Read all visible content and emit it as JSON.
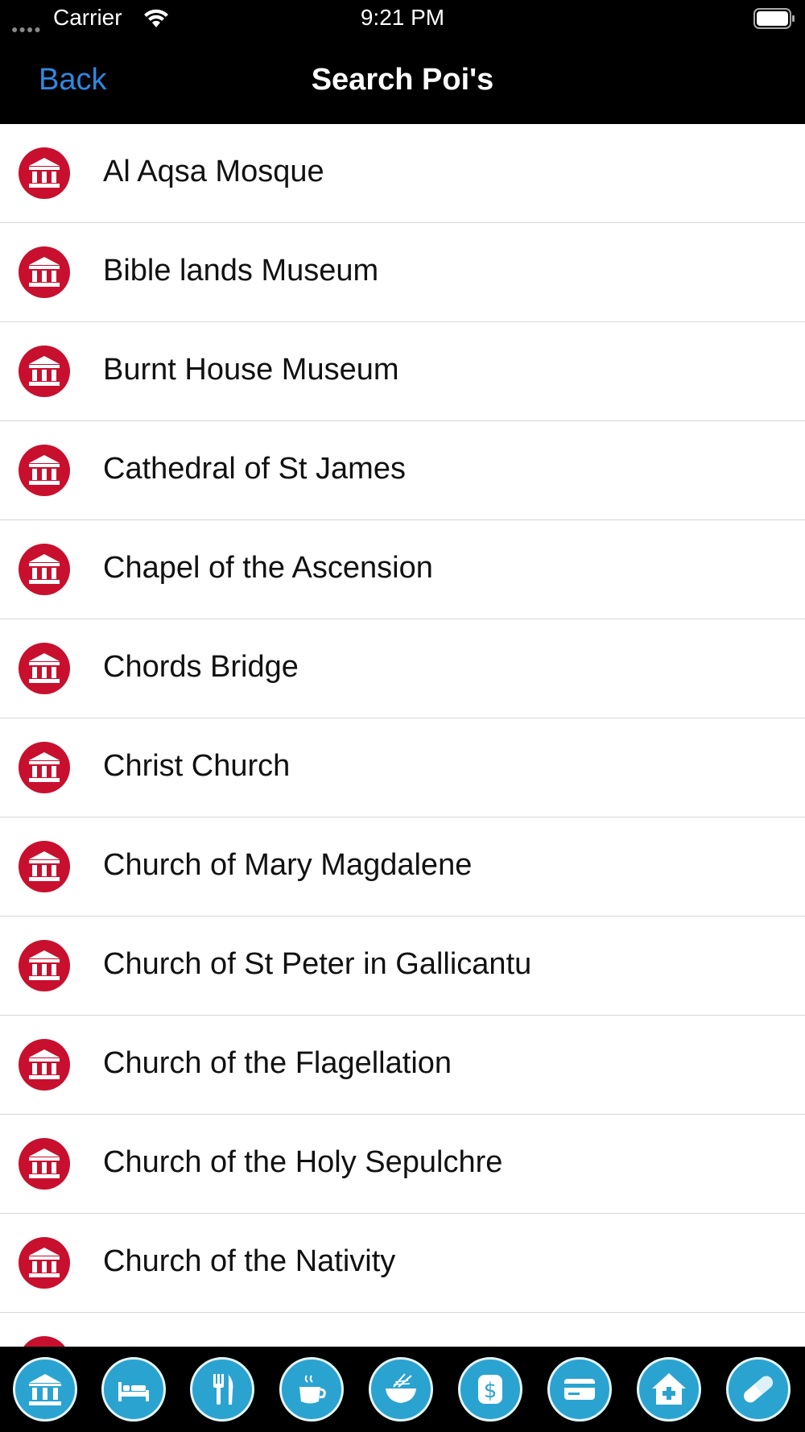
{
  "status_bar": {
    "carrier": "Carrier",
    "time": "9:21 PM"
  },
  "nav": {
    "back_label": "Back",
    "title": "Search Poi's"
  },
  "list": {
    "icon": "museum-icon",
    "items": [
      "Al Aqsa Mosque",
      "Bible lands Museum",
      "Burnt House Museum",
      "Cathedral of St James",
      "Chapel of the Ascension",
      "Chords Bridge",
      "Christ Church",
      "Church of Mary Magdalene",
      "Church of St Peter in Gallicantu",
      "Church of the Flagellation",
      "Church of the Holy Sepulchre",
      "Church of the Nativity"
    ]
  },
  "tab_bar": {
    "items": [
      {
        "icon": "museum-icon"
      },
      {
        "icon": "bed-icon"
      },
      {
        "icon": "fork-knife-icon"
      },
      {
        "icon": "coffee-cup-icon"
      },
      {
        "icon": "noodle-bowl-icon"
      },
      {
        "icon": "dollar-icon"
      },
      {
        "icon": "credit-card-icon"
      },
      {
        "icon": "hospital-house-icon"
      },
      {
        "icon": "pill-icon"
      }
    ]
  },
  "colors": {
    "accent_blue": "#2e88e0",
    "poi_icon_red": "#c8102e",
    "tab_icon_blue": "#2ba3d1",
    "bar_background": "#000000"
  }
}
